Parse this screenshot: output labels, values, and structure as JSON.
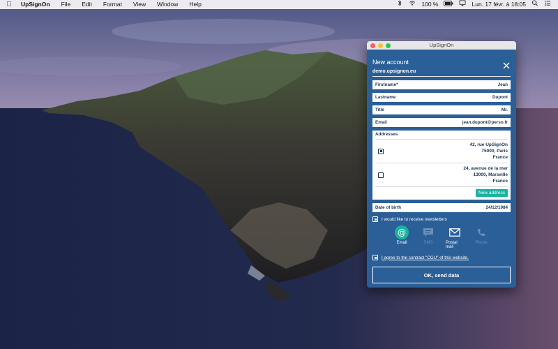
{
  "menubar": {
    "app_name": "UpSignOn",
    "items": [
      "File",
      "Edit",
      "Format",
      "View",
      "Window",
      "Help"
    ],
    "battery": "100 %",
    "datetime": "Lun. 17 févr. à 18:05"
  },
  "window": {
    "title": "UpSignOn",
    "heading": "New account",
    "domain": "demo.upsignon.eu",
    "accent_color": "#2b5f98",
    "button_color": "#19b3a2"
  },
  "fields": {
    "firstname": {
      "label": "Firstname*",
      "value": "Jean"
    },
    "lastname": {
      "label": "Lastname",
      "value": "Dupont"
    },
    "title": {
      "label": "Title",
      "value": "Mr."
    },
    "email": {
      "label": "Email",
      "value": "jean.dupont@perso.fr"
    },
    "birth": {
      "label": "Date of birth",
      "value": "24/12/1984"
    }
  },
  "addresses": {
    "label": "Addresses",
    "items": [
      {
        "line1": "42, rue UpSignOn",
        "line2": "75000, Paris",
        "line3": "France",
        "selected": true
      },
      {
        "line1": "24, avenue de la mer",
        "line2": "13000, Marseille",
        "line3": "France",
        "selected": false
      }
    ],
    "new_button": "New address"
  },
  "newsletter": {
    "label": "I would like to receive newsletters",
    "channels": [
      {
        "name": "Email",
        "icon": "at-icon",
        "active": true
      },
      {
        "name": "SMS",
        "icon": "sms-icon",
        "active": false
      },
      {
        "name": "Postal mail",
        "icon": "envelope-icon",
        "active": true
      },
      {
        "name": "Phone",
        "icon": "phone-icon",
        "active": false
      }
    ]
  },
  "cgu": {
    "label": "I agree to the contract \"CGU\" of this website."
  },
  "submit": {
    "label": "OK, send data"
  }
}
